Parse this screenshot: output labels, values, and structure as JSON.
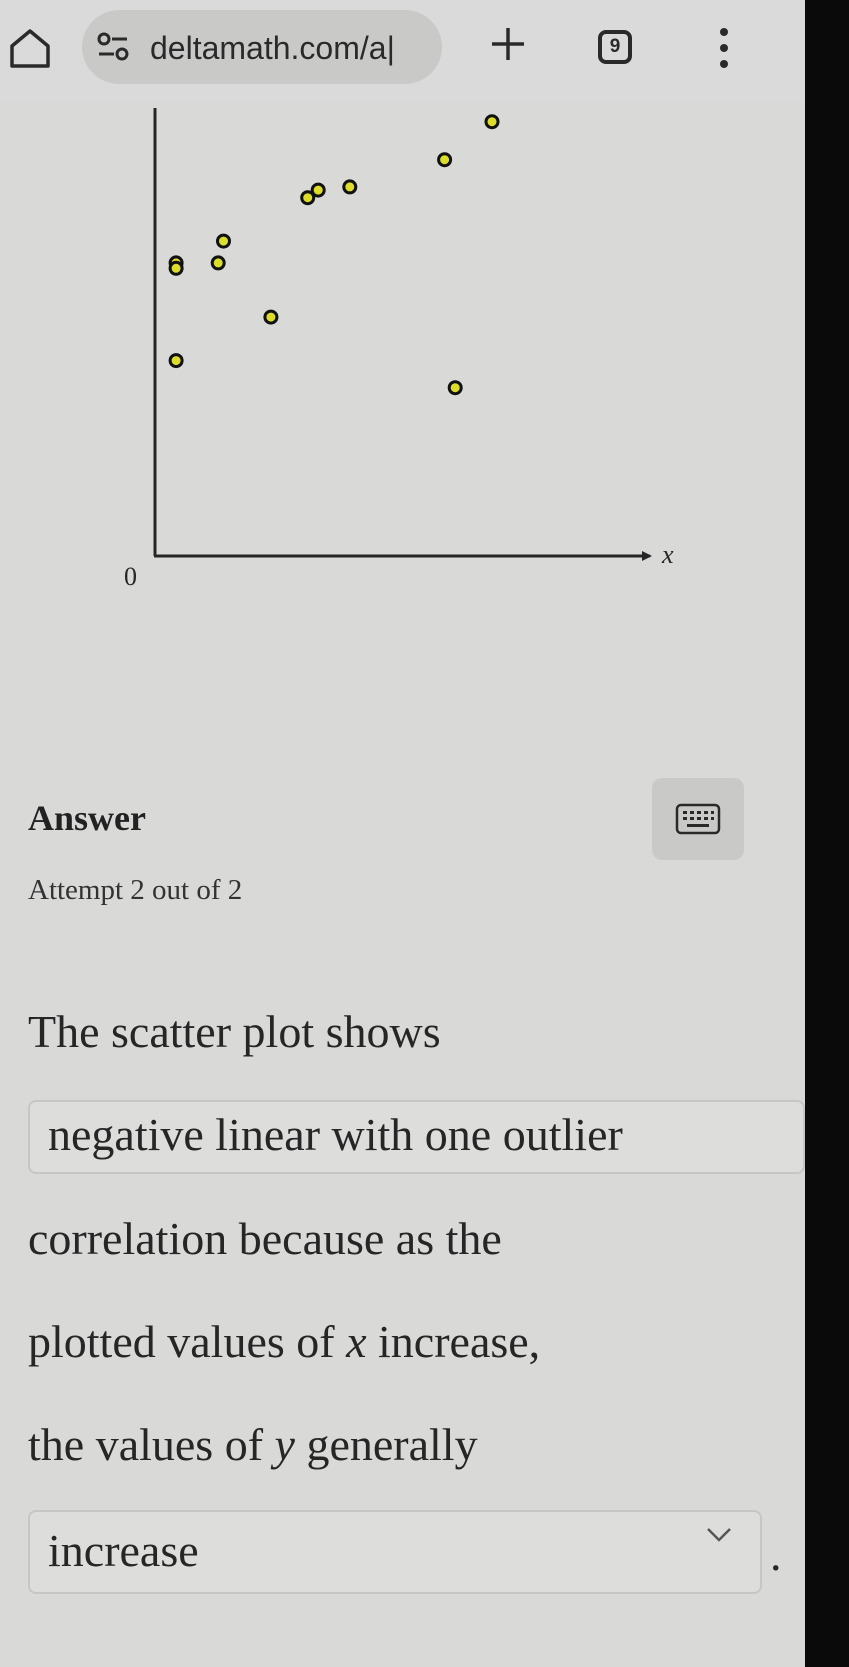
{
  "browser": {
    "url": "deltamath.com/a|",
    "tab_count": "9",
    "icons": [
      "home-icon",
      "site-settings-icon",
      "new-tab-icon",
      "tab-switcher-icon",
      "more-menu-icon"
    ]
  },
  "plot": {
    "origin_label": "0",
    "x_axis_label": "x",
    "point_color": "#dcdc2a",
    "point_outline": "#111111"
  },
  "chart_data": {
    "type": "scatter",
    "title": "",
    "xlabel": "x",
    "ylabel": "",
    "xlim": [
      0,
      47
    ],
    "ylim": [
      0,
      42
    ],
    "x_tick_labels": [
      "0"
    ],
    "grid": false,
    "legend": "none",
    "points": [
      {
        "x": 2,
        "y": 18
      },
      {
        "x": 2,
        "y": 27
      },
      {
        "x": 2,
        "y": 26.5
      },
      {
        "x": 6,
        "y": 27
      },
      {
        "x": 6.5,
        "y": 29
      },
      {
        "x": 11,
        "y": 22
      },
      {
        "x": 14.5,
        "y": 33
      },
      {
        "x": 15.5,
        "y": 33.7
      },
      {
        "x": 18.5,
        "y": 34
      },
      {
        "x": 27.5,
        "y": 36.5
      },
      {
        "x": 28.5,
        "y": 15.5
      },
      {
        "x": 32,
        "y": 40
      }
    ]
  },
  "answer": {
    "heading": "Answer",
    "attempt": "Attempt 2 out of 2",
    "line1": "The scatter plot shows",
    "correlation_choice": "negative linear with one outlier",
    "line2": "correlation because as the",
    "line3_pre": "plotted values of ",
    "line3_var": "x",
    "line3_post": " increase,",
    "line4_pre": "the values of ",
    "line4_var": "y",
    "line4_post": " generally",
    "trend_choice": "increase",
    "period": "."
  },
  "keyboard": {
    "icon": "keyboard-icon"
  }
}
